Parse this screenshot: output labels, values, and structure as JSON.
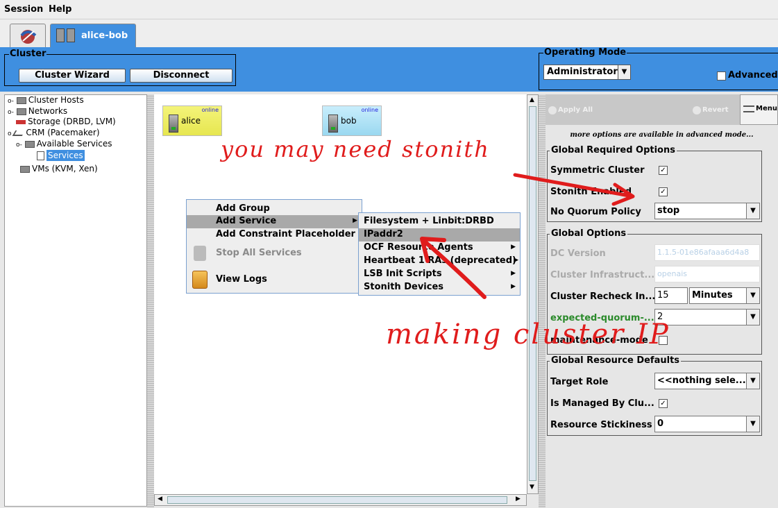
{
  "menubar": {
    "session": "Session",
    "help": "Help"
  },
  "tabs": [
    {
      "label": ""
    },
    {
      "label": "alice-bob"
    }
  ],
  "cluster_group": {
    "title": "Cluster",
    "wizard_label": "Cluster Wizard",
    "disconnect_label": "Disconnect"
  },
  "operating_mode": {
    "title": "Operating Mode",
    "value": "Administrator",
    "advanced_label": "Advanced"
  },
  "tree": {
    "items": [
      {
        "label": "Cluster Hosts"
      },
      {
        "label": "Networks"
      },
      {
        "label": "Storage (DRBD, LVM)"
      },
      {
        "label": "CRM (Pacemaker)"
      },
      {
        "label": "Available Services"
      },
      {
        "label": "Services"
      },
      {
        "label": "VMs (KVM, Xen)"
      }
    ]
  },
  "hosts": [
    {
      "name": "alice",
      "status": "online"
    },
    {
      "name": "bob",
      "status": "online"
    }
  ],
  "context_menu": {
    "items": [
      {
        "label": "Add Group"
      },
      {
        "label": "Add Service"
      },
      {
        "label": "Add Constraint Placeholder"
      },
      {
        "label": "Stop All Services"
      },
      {
        "label": "View Logs"
      }
    ]
  },
  "submenu": {
    "items": [
      {
        "label": "Filesystem + Linbit:DRBD"
      },
      {
        "label": "IPaddr2"
      },
      {
        "label": "OCF Resource Agents"
      },
      {
        "label": "Heartbeat 1 RAs (deprecated)"
      },
      {
        "label": "LSB Init Scripts"
      },
      {
        "label": "Stonith Devices"
      }
    ]
  },
  "right_toolbar": {
    "apply_all": "Apply All",
    "revert": "Revert",
    "menu": "Menu",
    "note": "more options are available in advanced mode..."
  },
  "global_required": {
    "title": "Global Required Options",
    "symmetric_cluster": "Symmetric Cluster",
    "stonith_enabled": "Stonith Enabled",
    "no_quorum_policy": "No Quorum Policy",
    "no_quorum_value": "stop"
  },
  "global_options": {
    "title": "Global Options",
    "dc_version": "DC Version",
    "dc_version_value": "1.1.5-01e86afaaa6d4a8",
    "cluster_infra": "Cluster Infrastruct...",
    "cluster_infra_value": "openais",
    "recheck": "Cluster Recheck In...",
    "recheck_value": "15",
    "recheck_unit": "Minutes",
    "expected_quorum": "expected-quorum-...",
    "expected_quorum_value": "2",
    "maintenance": "maintenance-mode"
  },
  "global_defaults": {
    "title": "Global Resource Defaults",
    "target_role": "Target Role",
    "target_role_value": "<<nothing sele...",
    "is_managed": "Is Managed By Clu...",
    "stickiness": "Resource Stickiness",
    "stickiness_value": "0"
  },
  "annotations": {
    "stonith": "you may need stonith",
    "cluster_ip": "making cluster IP"
  },
  "colors": {
    "toolbar_blue": "#3f8fe0",
    "annotation_red": "#e01c1c",
    "online_green": "#2a2"
  }
}
